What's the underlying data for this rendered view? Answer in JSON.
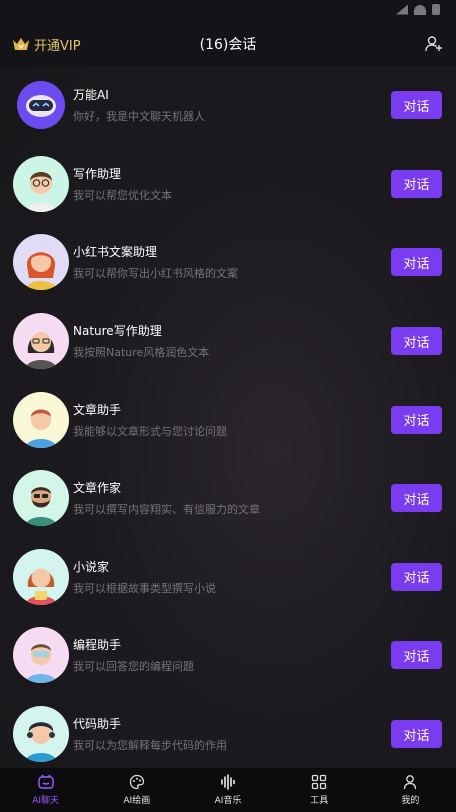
{
  "header": {
    "vip_label": "开通VIP",
    "title": "(16)会话"
  },
  "conversations": [
    {
      "name": "万能AI",
      "desc": "你好，我是中文聊天机器人",
      "button": "对话",
      "avatar_bg": "#6c4cf0"
    },
    {
      "name": "写作助理",
      "desc": "我可以帮您优化文本",
      "button": "对话",
      "avatar_bg": "#cdf5e6"
    },
    {
      "name": "小红书文案助理",
      "desc": "我可以帮你写出小红书风格的文案",
      "button": "对话",
      "avatar_bg": "#e0dcf8"
    },
    {
      "name": "Nature写作助理",
      "desc": "我按照Nature风格润色文本",
      "button": "对话",
      "avatar_bg": "#f6dcf2"
    },
    {
      "name": "文章助手",
      "desc": "我能够以文章形式与您讨论问题",
      "button": "对话",
      "avatar_bg": "#fbf8d8"
    },
    {
      "name": "文章作家",
      "desc": "我可以撰写内容翔实、有信服力的文章",
      "button": "对话",
      "avatar_bg": "#d2f7e8"
    },
    {
      "name": "小说家",
      "desc": "我可以根据故事类型撰写小说",
      "button": "对话",
      "avatar_bg": "#d3f4ef"
    },
    {
      "name": "编程助手",
      "desc": "我可以回答您的编程问题",
      "button": "对话",
      "avatar_bg": "#f6dcf2"
    },
    {
      "name": "代码助手",
      "desc": "我可以为您解释每步代码的作用",
      "button": "对话",
      "avatar_bg": "#d3f4ef"
    }
  ],
  "tabs": [
    {
      "label": "AI聊天",
      "active": true,
      "icon": "chat-bot-icon"
    },
    {
      "label": "AI绘画",
      "active": false,
      "icon": "palette-icon"
    },
    {
      "label": "AI音乐",
      "active": false,
      "icon": "sound-wave-icon"
    },
    {
      "label": "工具",
      "active": false,
      "icon": "grid-icon"
    },
    {
      "label": "我的",
      "active": false,
      "icon": "user-icon"
    }
  ],
  "colors": {
    "accent": "#7a3cf0",
    "vip_gold": "#e6c36a",
    "active_tab": "#9a5cff"
  }
}
